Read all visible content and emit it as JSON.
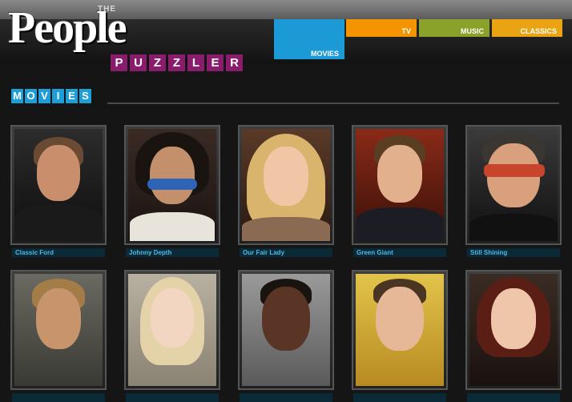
{
  "header": {
    "logo_the": "THE",
    "logo_people": "People",
    "puzzler_letters": [
      "P",
      "U",
      "Z",
      "Z",
      "L",
      "E",
      "R"
    ]
  },
  "nav": {
    "tabs": [
      {
        "label": "MOVIES",
        "color": "#1b9ad6",
        "active": true
      },
      {
        "label": "TV",
        "color": "#f39400"
      },
      {
        "label": "MUSIC",
        "color": "#8aa12a"
      },
      {
        "label": "CLASSICS",
        "color": "#e9a313"
      }
    ]
  },
  "section": {
    "title_letters": [
      "M",
      "O",
      "V",
      "I",
      "E",
      "S"
    ]
  },
  "cards": [
    {
      "label": "Classic Ford"
    },
    {
      "label": "Johnny Depth"
    },
    {
      "label": "Our Fair Lady"
    },
    {
      "label": "Green Giant"
    },
    {
      "label": "Still Shining"
    },
    {
      "label": ""
    },
    {
      "label": ""
    },
    {
      "label": ""
    },
    {
      "label": ""
    },
    {
      "label": ""
    }
  ]
}
